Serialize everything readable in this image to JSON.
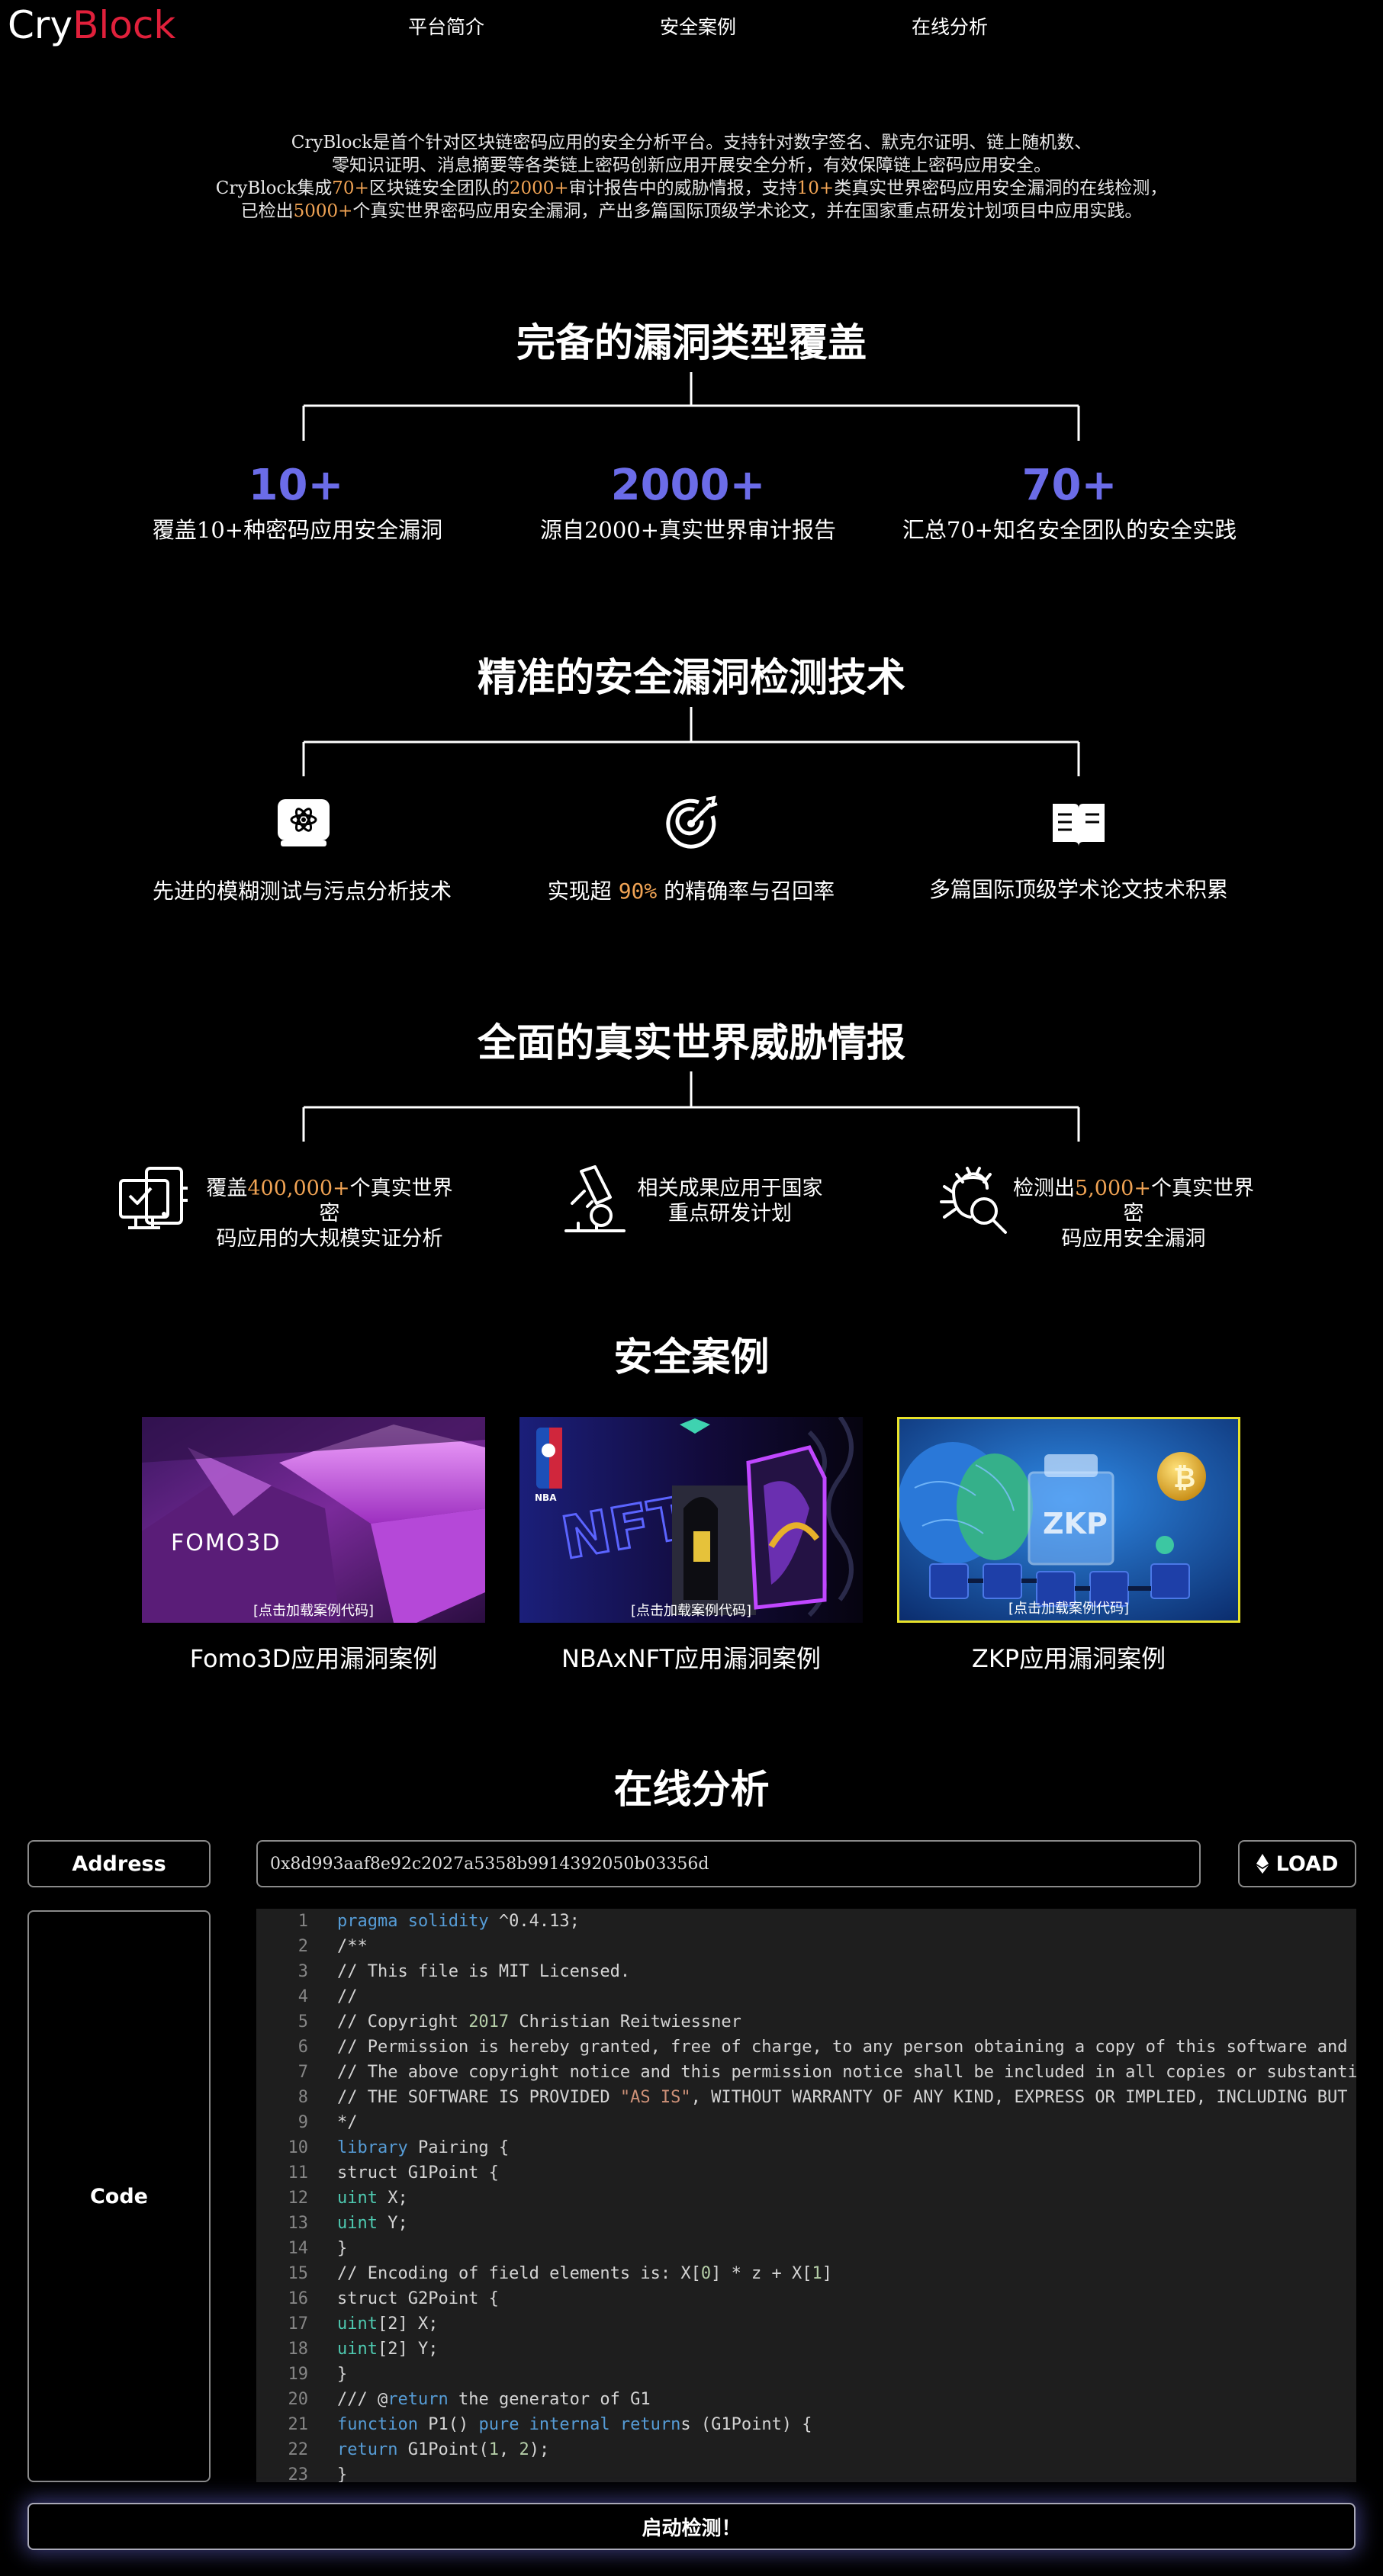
{
  "nav": {
    "logo_a": "Cry",
    "logo_b": "Block",
    "items": [
      "平台简介",
      "安全案例",
      "在线分析"
    ]
  },
  "intro": {
    "l1": "CryBlock是首个针对区块链密码应用的安全分析平台。支持针对数字签名、默克尔证明、链上随机数、",
    "l2": "零知识证明、消息摘要等各类链上密码创新应用开展安全分析，有效保障链上密码应用安全。",
    "l3a": "CryBlock集成",
    "l3b": "70+",
    "l3c": "区块链安全团队的",
    "l3d": "2000+",
    "l3e": "审计报告中的威胁情报，支持",
    "l3f": "10+",
    "l3g": "类真实世界密码应用安全漏洞的在线检测，",
    "l4a": "已检出",
    "l4b": "5000+",
    "l4c": "个真实世界密码应用安全漏洞，产出多篇国际顶级学术论文，并在国家重点研发计划项目中应用实践。"
  },
  "coverage": {
    "title": "完备的漏洞类型覆盖",
    "stats": [
      {
        "num": "10+",
        "desc": "覆盖10+种密码应用安全漏洞"
      },
      {
        "num": "2000+",
        "desc": "源自2000+真实世界审计报告"
      },
      {
        "num": "70+",
        "desc": "汇总70+知名安全团队的安全实践"
      }
    ]
  },
  "detection": {
    "title": "精准的安全漏洞检测技术",
    "f1": "先进的模糊测试与污点分析技术",
    "f2a": "实现超 ",
    "f2b": "90%",
    "f2c": " 的精确率与召回率",
    "f3": "多篇国际顶级学术论文技术积累"
  },
  "threat": {
    "title": "全面的真实世界威胁情报",
    "t1a": "覆盖",
    "t1b": "400,000+",
    "t1c": "个真实世界密",
    "t1d": "码应用的大规模实证分析",
    "t2a": "相关成果应用于国家",
    "t2b": "重点研发计划",
    "t3a": "检测出",
    "t3b": "5,000+",
    "t3c": "个真实世界密",
    "t3d": "码应用安全漏洞"
  },
  "cases": {
    "title": "安全案例",
    "caption": "[点击加载案例代码]",
    "fomo_logo": "FOMO3D",
    "nft_logo": "NFT",
    "nba_logo": "NBA",
    "zkp_logo": "ZKP",
    "items": [
      "Fomo3D应用漏洞案例",
      "NBAxNFT应用漏洞案例",
      "ZKP应用漏洞案例"
    ]
  },
  "analysis": {
    "title": "在线分析",
    "address_label": "Address",
    "address_value": "0x8d993aaf8e92c2027a5358b9914392050b03356d",
    "load_label": "LOAD",
    "code_label": "Code",
    "run_label": "启动检测！"
  },
  "code": {
    "lines": [
      "1",
      "2",
      "3",
      "4",
      "5",
      "6",
      "7",
      "8",
      "9",
      "10",
      "11",
      "12",
      "13",
      "14",
      "15",
      "16",
      "17",
      "18",
      "19",
      "20",
      "21",
      "22",
      "23"
    ],
    "l1a": "pragma solidity",
    "l1b": " ^0.4.13;",
    "l2": "/**",
    "l3": "// This file is MIT Licensed.",
    "l4": "//",
    "l5a": "// Copyright ",
    "l5b": "2017",
    "l5c": " Christian Reitwiessner",
    "l6": "// Permission is hereby granted, free of charge, to any person obtaining a copy of this software and a",
    "l7": "// The above copyright notice and this permission notice shall be included in all copies or substantia",
    "l8a": "// THE SOFTWARE IS PROVIDED ",
    "l8b": "\"AS IS\"",
    "l8c": ", WITHOUT WARRANTY OF ANY KIND, EXPRESS OR IMPLIED, INCLUDING BUT N",
    "l9": "*/",
    "l10a": "library",
    "l10b": " Pairing {",
    "l11": "struct G1Point {",
    "l12a": "uint",
    "l12b": " X;",
    "l13a": "uint",
    "l13b": " Y;",
    "l14": "}",
    "l15a": "// Encoding of field elements is: X[",
    "l15b": "0",
    "l15c": "] * z + X[",
    "l15d": "1",
    "l15e": "]",
    "l16": "struct G2Point {",
    "l17a": "uint",
    "l17b": "[2]",
    "l17c": " X;",
    "l18a": "uint",
    "l18b": "[2]",
    "l18c": " Y;",
    "l19": "}",
    "l20a": "/// @",
    "l20b": "return",
    "l20c": " the generator of G1",
    "l21a": "function",
    "l21b": " P1() ",
    "l21c": "pure internal return",
    "l21d": "s (G1Point) {",
    "l22a": "return",
    "l22b": " G1Point(",
    "l22c": "1",
    "l22d": ", ",
    "l22e": "2",
    "l22f": ");",
    "l23": "}"
  }
}
